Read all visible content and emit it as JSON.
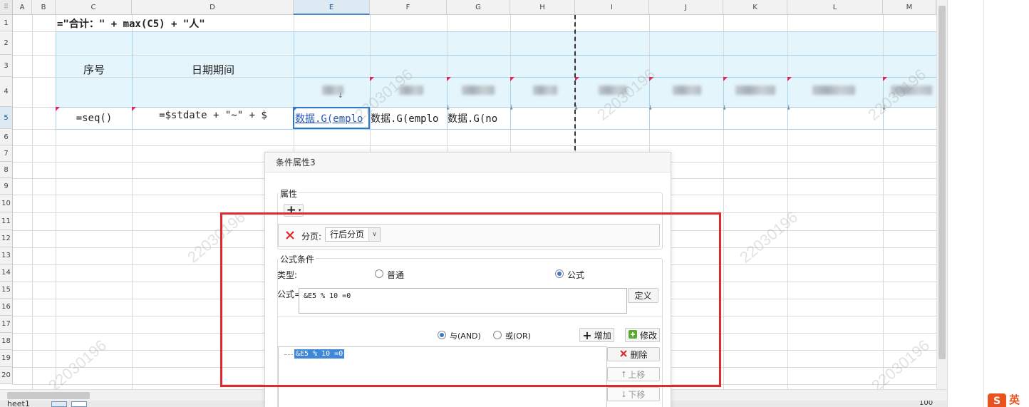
{
  "sheet": {
    "columns": [
      "A",
      "B",
      "C",
      "D",
      "E",
      "F",
      "G",
      "H",
      "I",
      "J",
      "K",
      "L",
      "M"
    ],
    "rows": [
      "1",
      "2",
      "3",
      "4",
      "5",
      "6",
      "7",
      "8",
      "9",
      "10",
      "11",
      "12",
      "13",
      "14",
      "15",
      "16",
      "17",
      "18",
      "19",
      "20"
    ],
    "selected_column": "E",
    "selected_row": "5",
    "cells": {
      "c1_formula": "=\"合计：\" + max(C5) + \"人\"",
      "c_header": "序号",
      "d_header": "日期期间",
      "c5": "=seq()",
      "d5": "=$stdate + \"~\" + $",
      "e5": "数据.G(emplo",
      "f5": "数据.G(emplo",
      "g5": "数据.G(no"
    },
    "watermark": "22030196",
    "sheet_tab": "heet1",
    "zoom": "100"
  },
  "dialog": {
    "title": "条件属性3",
    "attributes_label": "属性",
    "add_symbol": "+",
    "pagebreak_label": "分页",
    "pagebreak_value": "行后分页",
    "formula_condition_label": "公式条件",
    "type_label": "类型",
    "type_options": [
      {
        "label": "普通",
        "checked": false
      },
      {
        "label": "公式",
        "checked": true
      }
    ],
    "formula_label": "公式=",
    "formula_value": "&E5 % 10 =0",
    "define_button": "定义",
    "logic_options": [
      {
        "label": "与(AND)",
        "checked": true
      },
      {
        "label": "或(OR)",
        "checked": false
      }
    ],
    "add_button": "增加",
    "modify_button": "修改",
    "delete_button": "删除",
    "move_up_button": "上移",
    "move_down_button": "下移",
    "conditions": [
      "&E5 % 10 =0"
    ]
  },
  "app_logo_text": "英",
  "colors": {
    "highlight_red": "#e0282e",
    "header_band": "#e4f5fb",
    "selection_blue": "#2f78c9"
  }
}
